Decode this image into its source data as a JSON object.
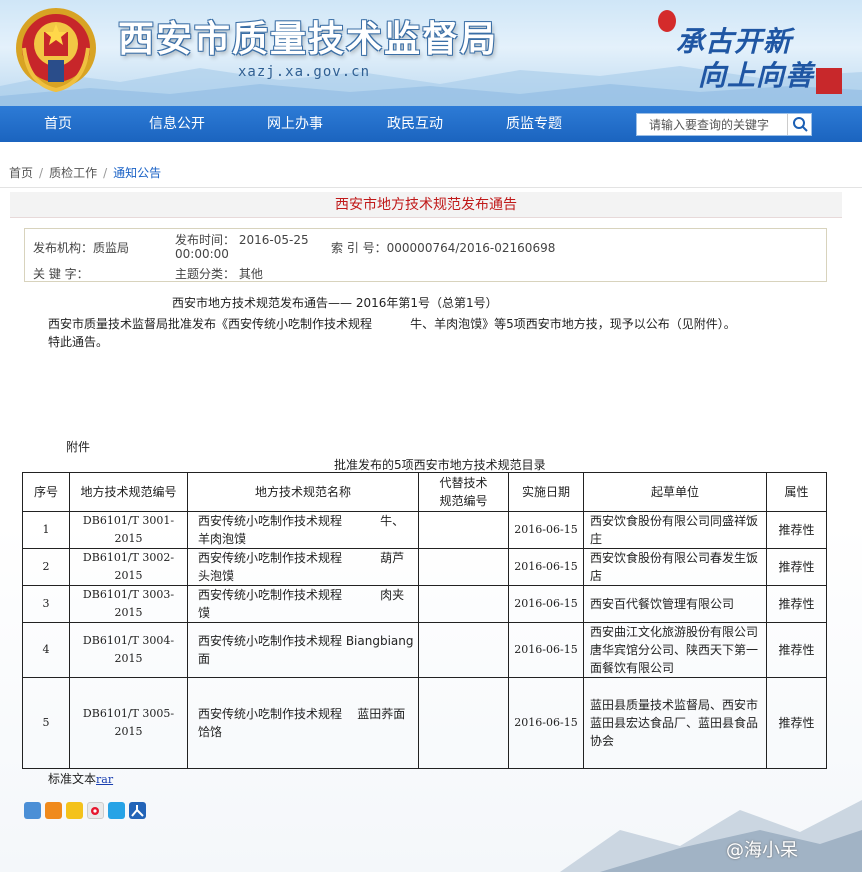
{
  "header": {
    "site_title": "西安市质量技术监督局",
    "site_url": "xazj.xa.gov.cn",
    "slogan_line1": "承古开新",
    "slogan_line2": "向上向善"
  },
  "nav": {
    "items": [
      {
        "label": "首页"
      },
      {
        "label": "信息公开"
      },
      {
        "label": "网上办事"
      },
      {
        "label": "政民互动"
      },
      {
        "label": "质监专题"
      }
    ],
    "search_placeholder": "请输入要查询的关键字"
  },
  "breadcrumb": {
    "items": [
      "首页",
      "质检工作",
      "通知公告"
    ]
  },
  "article": {
    "title": "西安市地方技术规范发布通告",
    "meta": {
      "org_label": "发布机构：",
      "org_value": "质监局",
      "time_label": "发布时间：",
      "time_value_line1": "2016-05-25",
      "time_value_line2": "00:00:00",
      "index_label": "索 引 号：",
      "index_value": "000000764/2016-02160698",
      "keyword_label": "关 键 字：",
      "keyword_value": "",
      "topic_label": "主题分类：",
      "topic_value": "其他"
    },
    "notice_heading": "西安市地方技术规范发布通告—— 2016年第1号（总第1号）",
    "body_line1": "西安市质量技术监督局批准发布《西安传统小吃制作技术规程          牛、羊肉泡馍》等5项西安市地方技，现予以公布（见附件）。",
    "body_line2": "特此通告。",
    "attachment_label": "附件",
    "table_caption": "批准发布的5项西安市地方技术规范目录"
  },
  "table": {
    "headers": [
      "序号",
      "地方技术规范编号",
      "地方技术规范名称",
      "代替技术\n规范编号",
      "实施日期",
      "起草单位",
      "属性"
    ],
    "rows": [
      {
        "no": "1",
        "code": "DB6101/T 3001-2015",
        "name": "西安传统小吃制作技术规程          牛、羊肉泡馍",
        "replace": "",
        "date": "2016-06-15",
        "org": "西安饮食股份有限公司同盛祥饭庄",
        "attr": "推荐性"
      },
      {
        "no": "2",
        "code": "DB6101/T 3002-2015",
        "name": "西安传统小吃制作技术规程          葫芦头泡馍",
        "replace": "",
        "date": "2016-06-15",
        "org": "西安饮食股份有限公司春发生饭店",
        "attr": "推荐性"
      },
      {
        "no": "3",
        "code": "DB6101/T 3003-2015",
        "name": "西安传统小吃制作技术规程          肉夹馍",
        "replace": "",
        "date": "2016-06-15",
        "org": "西安百代餐饮管理有限公司",
        "attr": "推荐性"
      },
      {
        "no": "4",
        "code": "DB6101/T 3004-2015",
        "name": "西安传统小吃制作技术规程 Biangbiang面",
        "replace": "",
        "date": "2016-06-15",
        "org": "西安曲江文化旅游股份有限公司唐华宾馆分公司、陕西天下第一面餐饮有限公司",
        "attr": "推荐性"
      },
      {
        "no": "5",
        "code": "DB6101/T 3005-2015",
        "name": "西安传统小吃制作技术规程    蓝田荞面饸饹",
        "replace": "",
        "date": "2016-06-15",
        "org": "蓝田县质量技术监督局、西安市蓝田县宏达食品厂、蓝田县食品协会",
        "attr": "推荐性"
      }
    ]
  },
  "attachment": {
    "label": "标准文本",
    "link": "rar"
  },
  "watermark": "@海小呆",
  "colors": {
    "nav_blue": "#1f6cc8",
    "title_red": "#c01a1a",
    "link_blue": "#1a62c6"
  }
}
